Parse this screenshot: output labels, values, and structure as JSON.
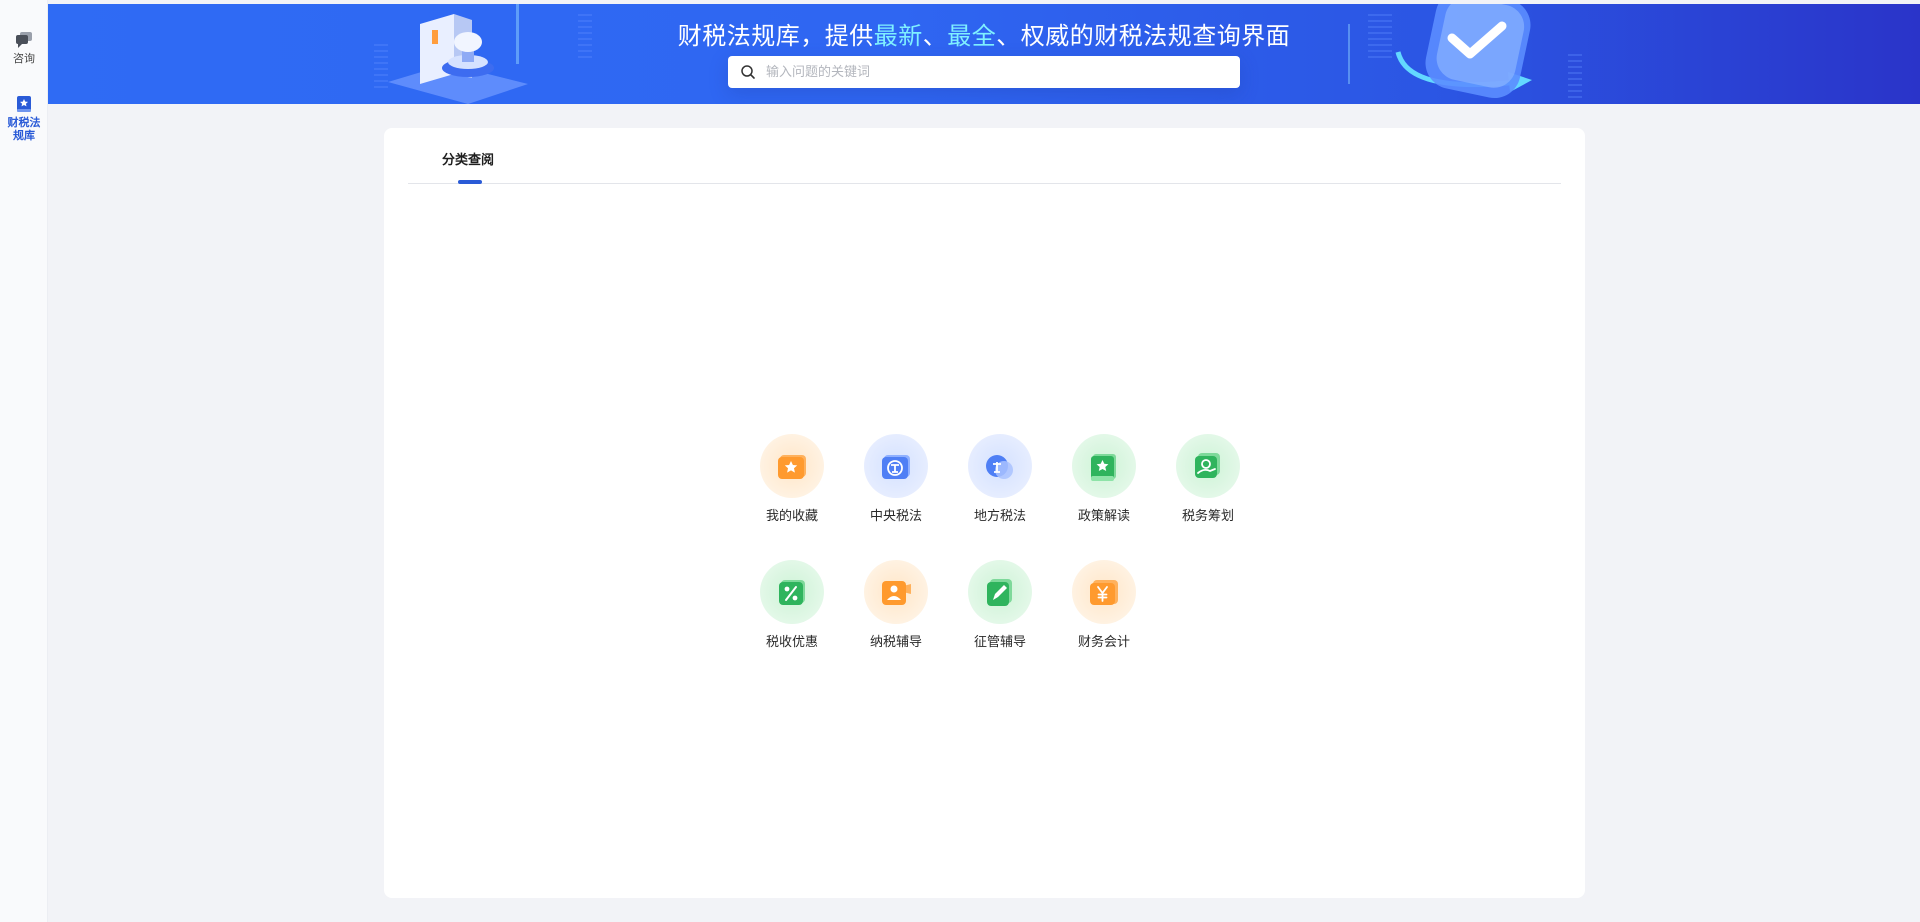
{
  "sidebar": {
    "items": [
      {
        "label": "咨询",
        "icon": "chat-bubbles-icon",
        "active": false
      },
      {
        "label": "财税法规库",
        "icon": "law-book-icon",
        "active": true
      }
    ]
  },
  "banner": {
    "title_prefix": "财税法规库，提供",
    "title_hl1": "最新",
    "title_sep1": "、",
    "title_hl2": "最全",
    "title_suffix": "、权威的财税法规查询界面",
    "highlight_color": "#7ff0ff"
  },
  "search": {
    "placeholder": "输入问题的关键词",
    "value": "",
    "icon": "search-icon"
  },
  "tabs": {
    "active_label": "分类查阅"
  },
  "categories": [
    {
      "label": "我的收藏",
      "icon": "favorites-star-icon",
      "color": "orange"
    },
    {
      "label": "中央税法",
      "icon": "central-tax-law-icon",
      "color": "blue"
    },
    {
      "label": "地方税法",
      "icon": "local-tax-law-icon",
      "color": "blue"
    },
    {
      "label": "政策解读",
      "icon": "policy-book-icon",
      "color": "green"
    },
    {
      "label": "税务筹划",
      "icon": "tax-planning-icon",
      "color": "green"
    },
    {
      "label": "税收优惠",
      "icon": "percent-icon",
      "color": "green"
    },
    {
      "label": "纳税辅导",
      "icon": "tax-guidance-icon",
      "color": "orange"
    },
    {
      "label": "征管辅导",
      "icon": "administration-pen-icon",
      "color": "green"
    },
    {
      "label": "财务会计",
      "icon": "yuan-accounting-icon",
      "color": "orange"
    }
  ]
}
